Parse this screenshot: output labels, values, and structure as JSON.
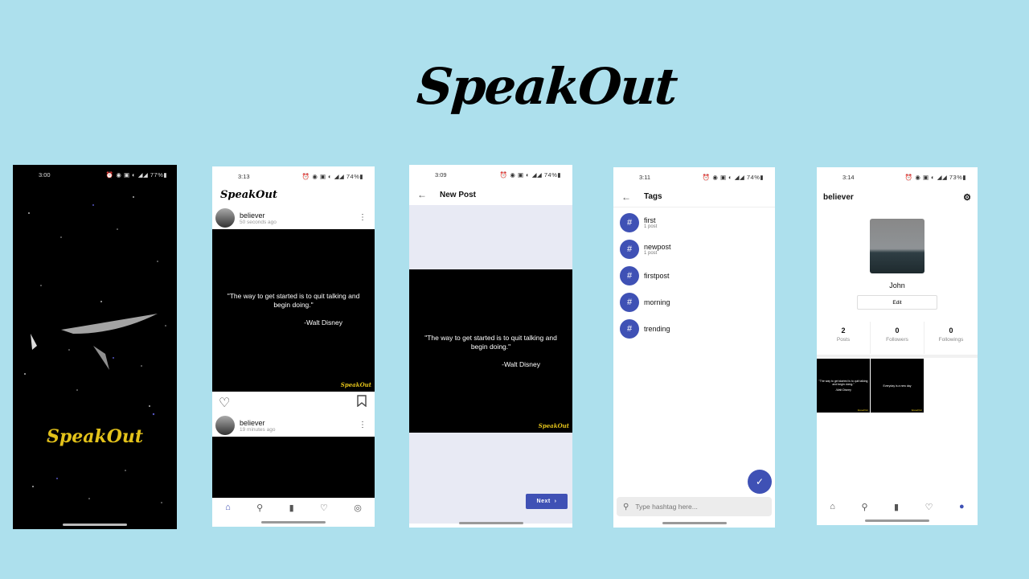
{
  "brand": {
    "title": "SpeakOut"
  },
  "splash": {
    "status": {
      "time": "3:00",
      "icons": "⏰ ◉ ▣ ◐ ◢◢ 77%▮"
    },
    "logo": "SpeakOut"
  },
  "feed": {
    "status": {
      "time": "3:13",
      "icons": "⏰ ◉ ▣ ◐ ◢◢ 74%▮"
    },
    "app_logo": "SpeakOut",
    "posts": [
      {
        "user": "believer",
        "time": "50 seconds ago"
      },
      {
        "user": "believer",
        "time": "19 minutes ago"
      }
    ],
    "quote": "\"The way to get started is to quit talking and begin doing.\"",
    "author": "-Walt Disney",
    "card_brand": "SpeakOut"
  },
  "new_post": {
    "status": {
      "time": "3:09",
      "icons": "⏰ ◉ ▣ ◐ ◢◢ 74%▮"
    },
    "title": "New Post",
    "quote": "\"The way to get started is to quit talking and begin doing.\"",
    "author": "-Walt Disney",
    "card_brand": "SpeakOut",
    "next_label": "Next"
  },
  "tags": {
    "status": {
      "time": "3:11",
      "icons": "⏰ ◉ ▣ ◐ ◢◢ 74%▮"
    },
    "title": "Tags",
    "items": [
      {
        "name": "first",
        "count": "1 post"
      },
      {
        "name": "newpost",
        "count": "1 post"
      },
      {
        "name": "firstpost",
        "count": ""
      },
      {
        "name": "morning",
        "count": ""
      },
      {
        "name": "trending",
        "count": ""
      }
    ],
    "search_placeholder": "Type hashtag here..."
  },
  "profile": {
    "status": {
      "time": "3:14",
      "icons": "⏰ ◉ ▣ ◐ ◢◢ 73%▮"
    },
    "username": "believer",
    "name": "John",
    "edit_label": "Edit",
    "stats": [
      {
        "value": "2",
        "label": "Posts"
      },
      {
        "value": "0",
        "label": "Followers"
      },
      {
        "value": "0",
        "label": "Followings"
      }
    ],
    "thumbs": [
      {
        "quote": "\"The way to get started is to quit talking and begin doing.\"",
        "author": "-Walt Disney",
        "brand": "SpeakOut"
      },
      {
        "quote": "Everyday is a new day",
        "author": "",
        "brand": "SpeakOut"
      }
    ]
  },
  "colors": {
    "background": "#ade0ed",
    "accent": "#3f51b5",
    "brand_yellow": "#e3c21a"
  },
  "nav_icons": [
    "home-icon",
    "search-icon",
    "map-icon",
    "heart-icon",
    "account-icon"
  ]
}
